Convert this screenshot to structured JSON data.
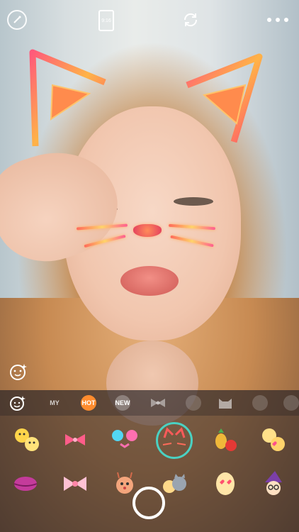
{
  "toolbar": {
    "ratio_label": "9:16",
    "icons": [
      "magic-wand-icon",
      "aspect-ratio-icon",
      "switch-camera-icon",
      "more-menu-icon"
    ]
  },
  "category_tabs": [
    {
      "id": "beauty",
      "icon": "beauty-face-icon"
    },
    {
      "id": "my",
      "label": "MY"
    },
    {
      "id": "hot",
      "label": "HOT",
      "selected": true
    },
    {
      "id": "new",
      "label": "NEW"
    },
    {
      "id": "bow",
      "icon": "bow-icon"
    },
    {
      "id": "face",
      "icon": "face-icon"
    },
    {
      "id": "cat",
      "icon": "cat-icon"
    },
    {
      "id": "more1",
      "icon": "sticker-category-icon"
    },
    {
      "id": "more2",
      "icon": "sticker-category-icon"
    }
  ],
  "stickers_row1": [
    "emoji-faces-sticker",
    "bow-sparkles-sticker",
    "mouse-ears-sticker",
    "cat-whiskers-sticker",
    "fruit-sticker",
    "heart-glasses-sticker"
  ],
  "stickers_row2": [
    "lips-sticker",
    "bow-headband-sticker",
    "deer-sticker",
    "cat-friends-sticker",
    "heart-eyes-sticker",
    "witch-sticker"
  ],
  "colors": {
    "accent_hot": "#ff8c2e",
    "selected_ring": "#4ad1c2",
    "panel_bg": "#302a2c"
  }
}
